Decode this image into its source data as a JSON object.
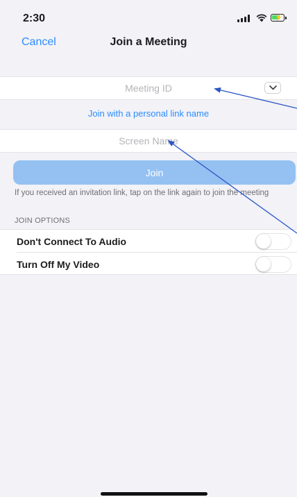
{
  "status_bar": {
    "time": "2:30",
    "battery_level": 0.7,
    "battery_color": "#4cd964",
    "icons": [
      "signal-icon",
      "wifi-icon",
      "battery-charging-icon"
    ]
  },
  "nav": {
    "cancel_label": "Cancel",
    "title": "Join a Meeting"
  },
  "form": {
    "meeting_id": {
      "value": "",
      "placeholder": "Meeting ID"
    },
    "dropdown_icon": "chevron-down-icon",
    "personal_link_label": "Join with a personal link name",
    "screen_name": {
      "value": "",
      "placeholder": "Screen Name"
    },
    "join_label": "Join",
    "hint": "If you received an invitation link, tap on the link again to join the meeting"
  },
  "join_options": {
    "header": "JOIN OPTIONS",
    "items": [
      {
        "label": "Don't Connect To Audio",
        "enabled": false
      },
      {
        "label": "Turn Off My Video",
        "enabled": false
      }
    ]
  },
  "colors": {
    "accent": "#2d8cff",
    "join_button": "#94c1f2",
    "background": "#f2f2f7",
    "annotation_arrow": "#2a55c5"
  }
}
